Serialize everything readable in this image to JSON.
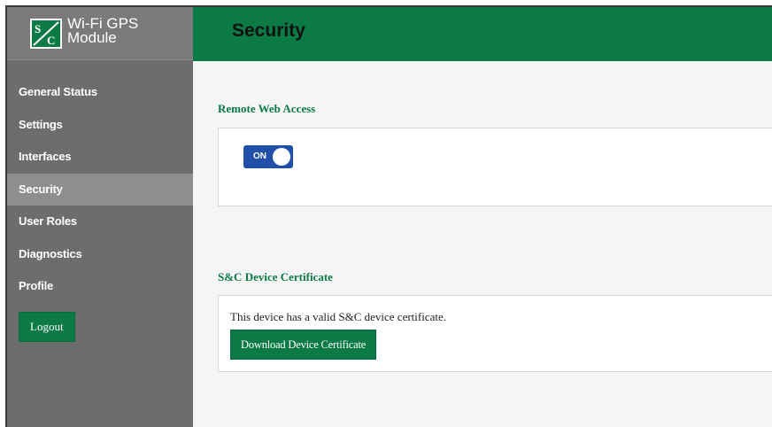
{
  "brand": {
    "logo_text": "S&C",
    "title_line1": "Wi-Fi GPS",
    "title_line2": "Module"
  },
  "page": {
    "title": "Security"
  },
  "sidebar": {
    "items": [
      {
        "label": "General Status"
      },
      {
        "label": "Settings"
      },
      {
        "label": "Interfaces"
      },
      {
        "label": "Security",
        "active": true
      },
      {
        "label": "User Roles"
      },
      {
        "label": "Diagnostics"
      },
      {
        "label": "Profile"
      }
    ],
    "logout_label": "Logout"
  },
  "remote_access": {
    "title": "Remote Web Access",
    "toggle_label": "ON",
    "toggle_state": true
  },
  "certificate": {
    "title": "S&C Device Certificate",
    "status_text": "This device has a valid S&C device certificate.",
    "download_label": "Download Device Certificate"
  },
  "colors": {
    "accent_green": "#0c7a45",
    "sidebar_bg": "#6d6d6d",
    "toggle_blue": "#1f4fa8"
  }
}
